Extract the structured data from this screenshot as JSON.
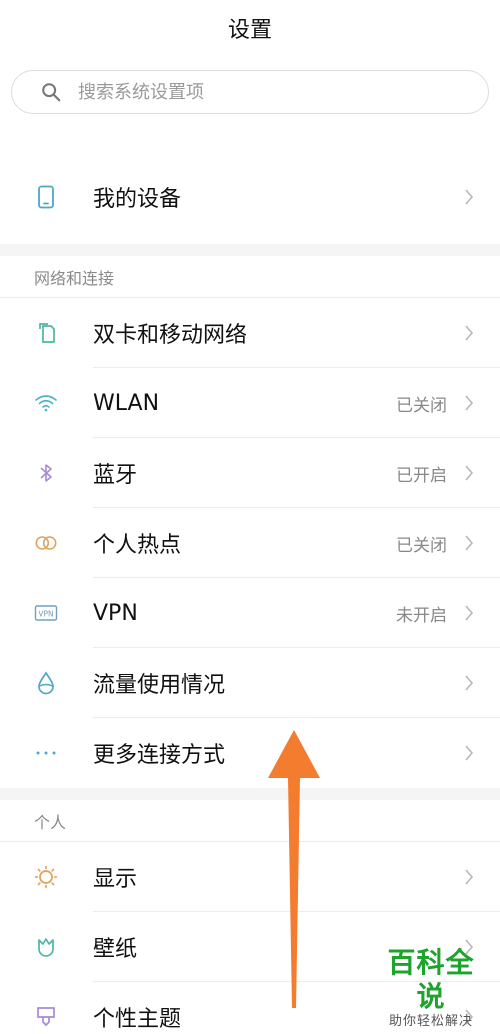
{
  "header": {
    "title": "设置"
  },
  "search": {
    "placeholder": "搜索系统设置项"
  },
  "top_items": [
    {
      "label": "我的设备",
      "icon": "phone-icon"
    }
  ],
  "sections": [
    {
      "header": "网络和连接",
      "items": [
        {
          "label": "双卡和移动网络",
          "status": "",
          "icon": "sim-card-icon"
        },
        {
          "label": "WLAN",
          "status": "已关闭",
          "icon": "wifi-icon"
        },
        {
          "label": "蓝牙",
          "status": "已开启",
          "icon": "bluetooth-icon"
        },
        {
          "label": "个人热点",
          "status": "已关闭",
          "icon": "hotspot-icon"
        },
        {
          "label": "VPN",
          "status": "未开启",
          "icon": "vpn-icon"
        },
        {
          "label": "流量使用情况",
          "status": "",
          "icon": "data-drop-icon"
        },
        {
          "label": "更多连接方式",
          "status": "",
          "icon": "more-dots-icon"
        }
      ]
    },
    {
      "header": "个人",
      "items": [
        {
          "label": "显示",
          "status": "",
          "icon": "sun-icon"
        },
        {
          "label": "壁纸",
          "status": "",
          "icon": "wallpaper-icon"
        },
        {
          "label": "个性主题",
          "status": "",
          "icon": "theme-brush-icon"
        }
      ]
    }
  ],
  "watermark": {
    "title": "百科全说",
    "subtitle": "助你轻松解决"
  },
  "colors": {
    "accent_arrow": "#f47c2f",
    "icon_teal": "#5bb8c4",
    "icon_purple": "#a78bd6",
    "icon_orange": "#e0a15a",
    "icon_gray_blue": "#6f9fbf",
    "watermark_green": "#1ea32d"
  }
}
